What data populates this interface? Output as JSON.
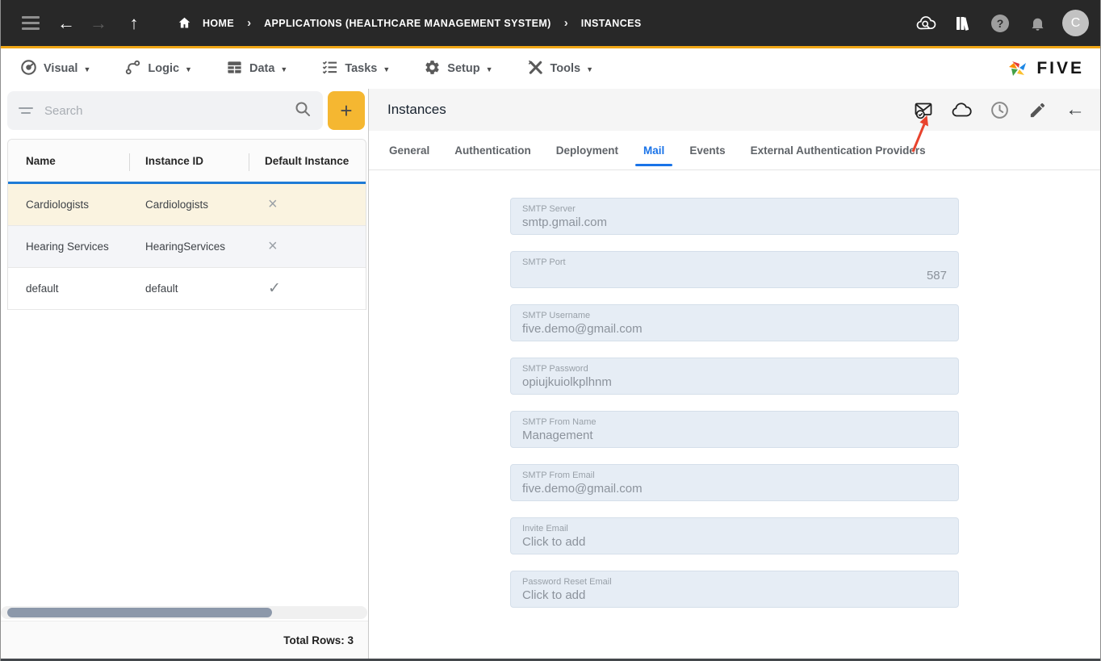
{
  "topbar": {
    "chevron_glyph": "›",
    "back_glyph": "←",
    "forward_glyph": "→",
    "up_glyph": "↑",
    "breadcrumb": {
      "home": "HOME",
      "app": "APPLICATIONS (HEALTHCARE MANAGEMENT SYSTEM)",
      "page": "INSTANCES"
    },
    "help_glyph": "?",
    "avatar_initial": "C"
  },
  "menubar": {
    "caret_glyph": "▼",
    "items": [
      {
        "label": "Visual"
      },
      {
        "label": "Logic"
      },
      {
        "label": "Data"
      },
      {
        "label": "Tasks"
      },
      {
        "label": "Setup"
      },
      {
        "label": "Tools"
      }
    ],
    "brand": "FIVE"
  },
  "left_panel": {
    "search_placeholder": "Search",
    "add_button_glyph": "+",
    "table": {
      "columns": [
        "Name",
        "Instance ID",
        "Default Instance"
      ],
      "rows": [
        {
          "name": "Cardiologists",
          "instance_id": "Cardiologists",
          "default_instance": "no",
          "glyph": "×",
          "selected": true
        },
        {
          "name": "Hearing Services",
          "instance_id": "HearingServices",
          "default_instance": "no",
          "glyph": "×",
          "selected": false
        },
        {
          "name": "default",
          "instance_id": "default",
          "default_instance": "yes",
          "glyph": "✓",
          "selected": false
        }
      ]
    },
    "footer": {
      "total_rows": "Total Rows: 3"
    }
  },
  "right_panel": {
    "title": "Instances",
    "back_glyph": "←",
    "tabs": [
      {
        "label": "General"
      },
      {
        "label": "Authentication"
      },
      {
        "label": "Deployment"
      },
      {
        "label": "Mail",
        "active": true
      },
      {
        "label": "Events"
      },
      {
        "label": "External Authentication Providers"
      }
    ],
    "form": {
      "fields": [
        {
          "label": "SMTP Server",
          "value": "smtp.gmail.com"
        },
        {
          "label": "SMTP Port",
          "value": "587"
        },
        {
          "label": "SMTP Username",
          "value": "five.demo@gmail.com"
        },
        {
          "label": "SMTP Password",
          "value": "opiujkuiolkplhnm"
        },
        {
          "label": "SMTP From Name",
          "value": "Management"
        },
        {
          "label": "SMTP From Email",
          "value": "five.demo@gmail.com"
        },
        {
          "label": "Invite Email",
          "value": "Click to add"
        },
        {
          "label": "Password Reset Email",
          "value": "Click to add"
        }
      ]
    }
  },
  "colors": {
    "topbar_bg": "#282828",
    "accent_yellow": "#F0A716",
    "add_button_yellow": "#F5B731",
    "active_tab_blue": "#1A73E8",
    "table_accent_blue": "#1E7BD6",
    "selected_row_cream": "#FAF3E0",
    "field_bg": "#E6EDF5",
    "annotation_red": "#E8432D"
  }
}
